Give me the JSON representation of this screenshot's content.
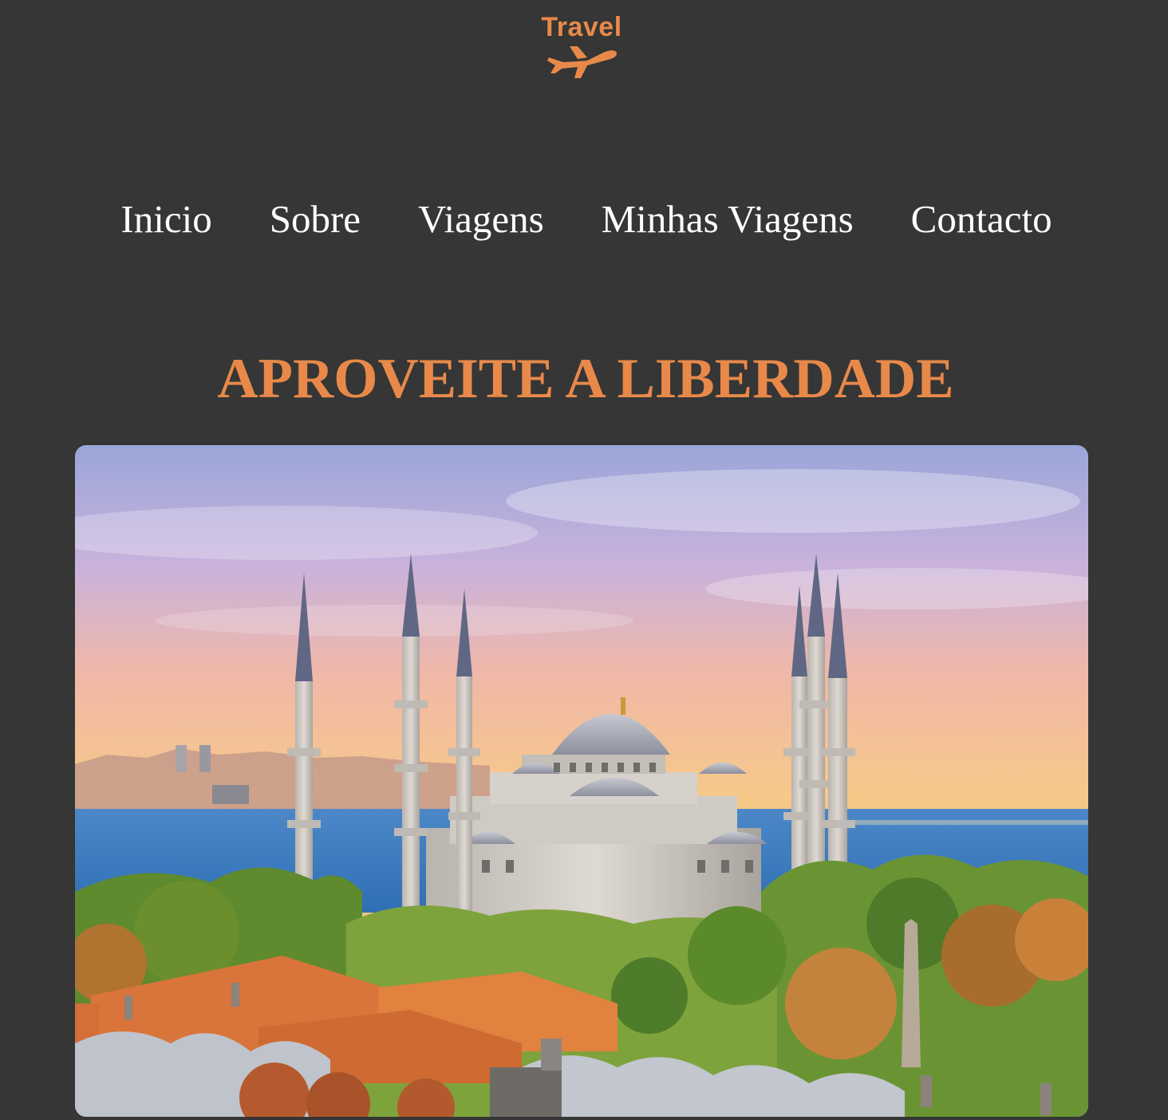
{
  "header": {
    "logo_text": "Travel",
    "logo_icon": "airplane-icon",
    "brand_color": "#e8894a"
  },
  "nav": {
    "items": [
      {
        "label": "Inicio"
      },
      {
        "label": "Sobre"
      },
      {
        "label": "Viagens"
      },
      {
        "label": "Minhas Viagens"
      },
      {
        "label": "Contacto"
      }
    ]
  },
  "hero": {
    "title": "APROVEITE A LIBERDADE",
    "image_subject": "mosque-with-minarets-by-the-sea-at-sunset"
  },
  "colors": {
    "background": "#353635",
    "accent": "#e8894a",
    "nav_text": "#ffffff"
  }
}
